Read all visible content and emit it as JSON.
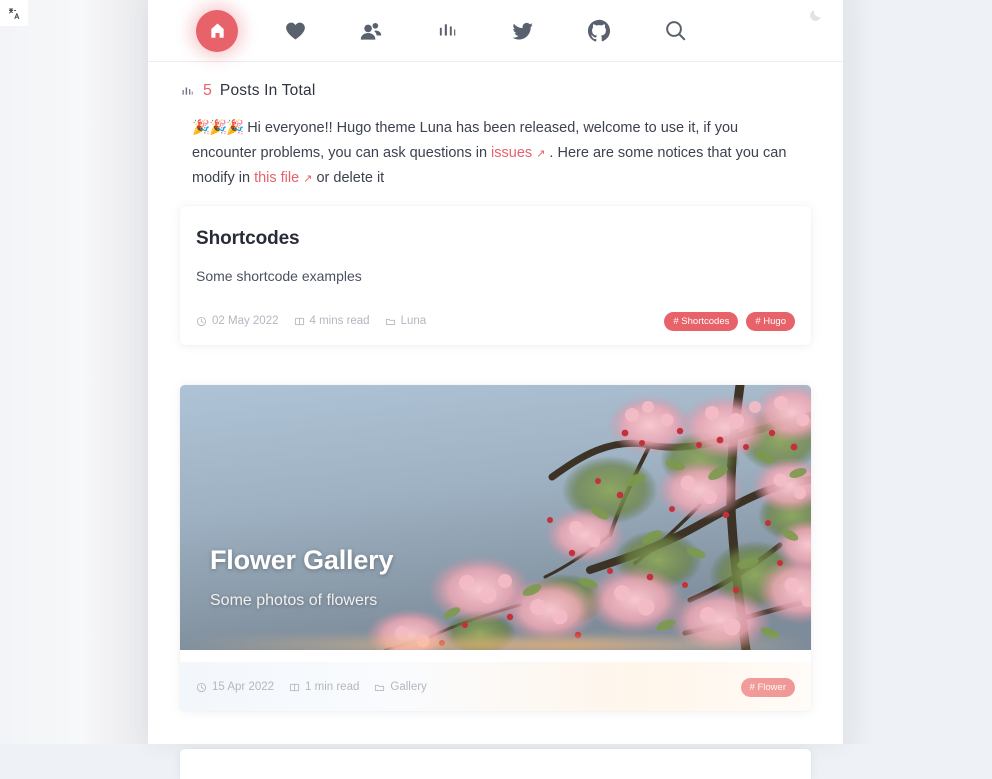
{
  "browser": {
    "translate_icon": "translate-icon"
  },
  "header": {
    "nav": [
      {
        "name": "home",
        "icon": "home-icon",
        "active": true
      },
      {
        "name": "likes",
        "icon": "heart-icon",
        "active": false
      },
      {
        "name": "friends",
        "icon": "people-icon",
        "active": false
      },
      {
        "name": "stats",
        "icon": "bar-chart-icon",
        "active": false
      },
      {
        "name": "twitter",
        "icon": "twitter-icon",
        "active": false
      },
      {
        "name": "github",
        "icon": "github-icon",
        "active": false
      },
      {
        "name": "search",
        "icon": "search-icon",
        "active": false
      }
    ],
    "theme_toggle_icon": "moon-icon"
  },
  "posts_total": {
    "icon": "bar-chart-icon",
    "count": "5",
    "label": "Posts In Total"
  },
  "notice": {
    "emoji": "🎉🎉🎉",
    "text_1": " Hi everyone!! Hugo theme Luna has been released, welcome to use it, if you encounter problems, you can ask questions in ",
    "link_1": "issues",
    "link_1_arrow": "↗",
    "text_2": " . Here are some notices that you can modify in ",
    "link_2": "this file",
    "link_2_arrow": "↗",
    "text_3": " or delete it"
  },
  "posts": [
    {
      "title": "Shortcodes",
      "description": "Some shortcode examples",
      "date": "02 May 2022",
      "date_icon": "clock-icon",
      "read_time": "4 mins read",
      "read_icon": "book-icon",
      "category": "Luna",
      "category_icon": "folder-icon",
      "tags": [
        "# Shortcodes",
        "# Hugo"
      ],
      "has_hero": false
    },
    {
      "title": "Flower Gallery",
      "description": "Some photos of flowers",
      "date": "15 Apr 2022",
      "date_icon": "clock-icon",
      "read_time": "1 min read",
      "read_icon": "book-icon",
      "category": "Gallery",
      "category_icon": "folder-icon",
      "tags": [
        "# Flower"
      ],
      "has_hero": true,
      "hero_image": "cherry-blossom-photo"
    }
  ],
  "colors": {
    "accent": "#e8626a",
    "page_bg": "#eef1f5",
    "card_bg": "#ffffff",
    "text_primary": "#272c38",
    "text_muted": "#b3b7c0",
    "nav_icon": "#5a616e"
  }
}
